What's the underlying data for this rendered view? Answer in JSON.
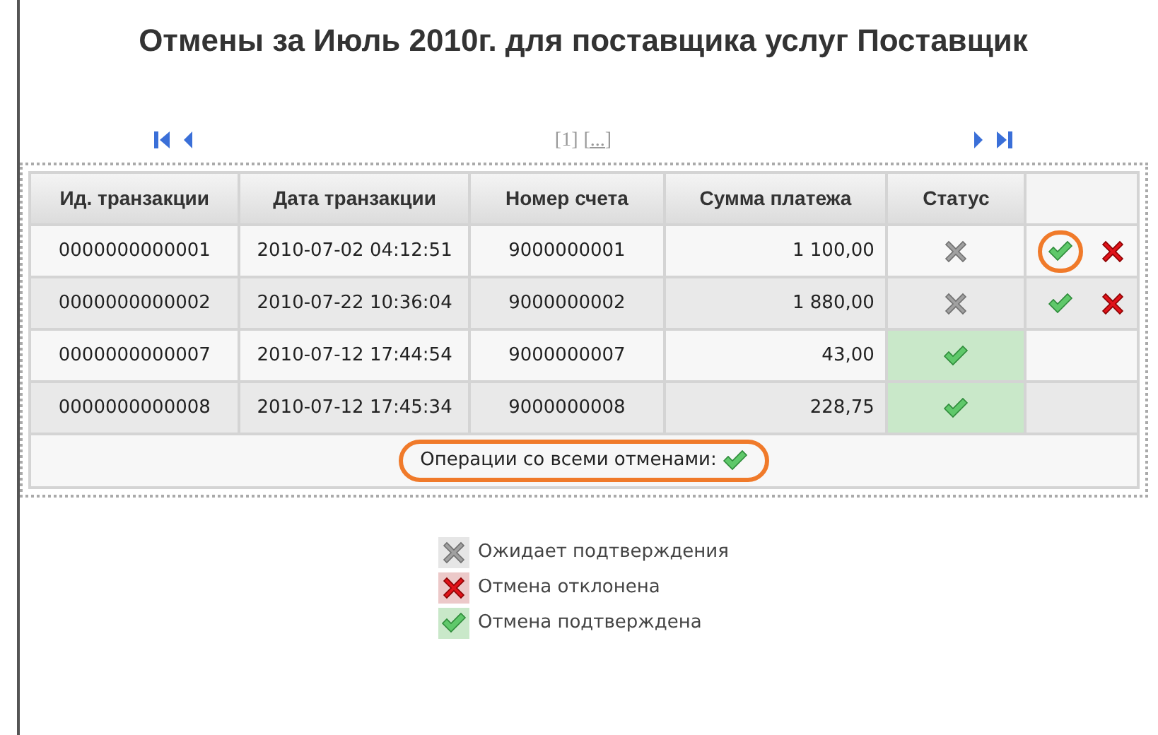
{
  "title": "Отмены за Июль 2010г. для поставщика услуг Поставщик",
  "pager": {
    "pages": "[1]",
    "more": "[...]"
  },
  "table": {
    "columns": [
      "Ид. транзакции",
      "Дата транзакции",
      "Номер счета",
      "Сумма платежа",
      "Статус"
    ],
    "rows": [
      {
        "id": "0000000000001",
        "date": "2010-07-02 04:12:51",
        "account": "9000000001",
        "amount": "1 100,00",
        "kind": "pending",
        "actions": true,
        "highlighted": true
      },
      {
        "id": "0000000000002",
        "date": "2010-07-22 10:36:04",
        "account": "9000000002",
        "amount": "1 880,00",
        "kind": "pending",
        "actions": true,
        "highlighted": false
      },
      {
        "id": "0000000000007",
        "date": "2010-07-12 17:44:54",
        "account": "9000000007",
        "amount": "43,00",
        "kind": "confirmed",
        "actions": false,
        "highlighted": false
      },
      {
        "id": "0000000000008",
        "date": "2010-07-12 17:45:34",
        "account": "9000000008",
        "amount": "228,75",
        "kind": "confirmed",
        "actions": false,
        "highlighted": false
      }
    ],
    "footer": {
      "label": "Операции со всеми отменами:",
      "highlighted": true
    }
  },
  "legend": [
    {
      "kind": "pending",
      "label": "Ожидает подтверждения"
    },
    {
      "kind": "rejected",
      "label": "Отмена отклонена"
    },
    {
      "kind": "confirmed",
      "label": "Отмена подтверждена"
    }
  ]
}
